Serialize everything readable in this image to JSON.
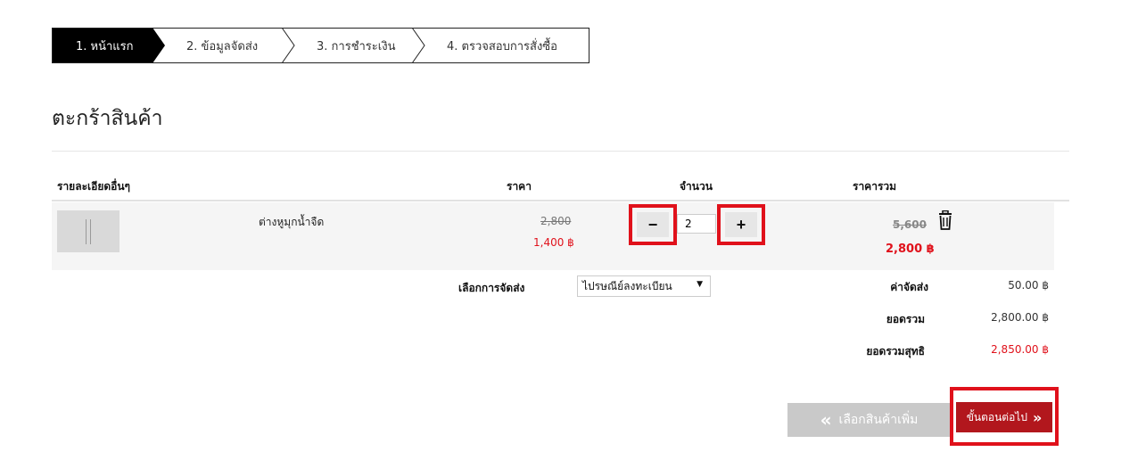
{
  "steps": [
    "1. หน้าแรก",
    "2. ข้อมูลจัดส่ง",
    "3. การชำระเงิน",
    "4. ตรวจสอบการสั่งซื้อ"
  ],
  "page_title": "ตะกร้าสินค้า",
  "table": {
    "headers": {
      "details": "รายละเอียดอื่นๆ",
      "price": "ราคา",
      "quantity": "จำนวน",
      "total": "ราคารวม"
    },
    "items": [
      {
        "name": "ต่างหูมุกน้ำจืด",
        "old_price": "2,800",
        "price": "1,400 ฿",
        "qty": "2",
        "old_total": "5,600",
        "total": "2,800 ฿"
      }
    ]
  },
  "qty_controls": {
    "minus": "−",
    "plus": "+"
  },
  "shipping": {
    "label": "เลือกการจัดส่ง",
    "selected": "ไปรษณีย์ลงทะเบียน"
  },
  "summary": {
    "shipping_label": "ค่าจัดส่ง",
    "shipping_value": "50.00 ฿",
    "subtotal_label": "ยอดรวม",
    "subtotal_value": "2,800.00 ฿",
    "net_label": "ยอดรวมสุทธิ",
    "net_value": "2,850.00 ฿"
  },
  "buttons": {
    "back_icon": "«",
    "back": "เลือกสินค้าเพิ่ม",
    "next": "ขั้นตอนต่อไป",
    "next_icon": "»"
  },
  "icons": {
    "trash": "trash-icon"
  },
  "colors": {
    "accent": "#e0111b",
    "next_button": "#b2171d",
    "back_button": "#c9c9c9"
  }
}
